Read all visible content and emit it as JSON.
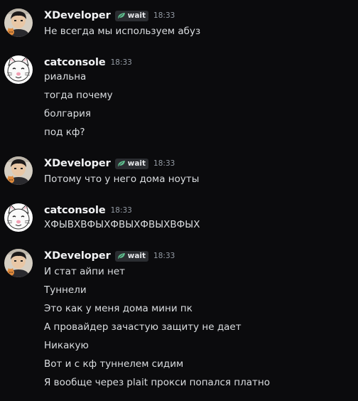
{
  "groups": [
    {
      "username": "XDeveloper",
      "tag": "wait",
      "timestamp": "18:33",
      "avatar": "xdeveloper-avatar",
      "lines": [
        "Не всегда мы используем абуз"
      ]
    },
    {
      "username": "catconsole",
      "timestamp": "18:33",
      "avatar": "catconsole-avatar",
      "lines": [
        "риальна",
        "тогда почему",
        "болгария",
        "под кф?"
      ]
    },
    {
      "username": "XDeveloper",
      "tag": "wait",
      "timestamp": "18:33",
      "avatar": "xdeveloper-avatar",
      "lines": [
        "Потому что у него дома ноуты"
      ]
    },
    {
      "username": "catconsole",
      "timestamp": "18:33",
      "avatar": "catconsole-avatar",
      "lines": [
        "ХФЫВХВФЫХФВЫХФВЫХВФЫХ"
      ]
    },
    {
      "username": "XDeveloper",
      "tag": "wait",
      "timestamp": "18:33",
      "avatar": "xdeveloper-avatar",
      "lines": [
        "И стат айпи нет",
        "Туннели",
        "Это как у меня дома мини пк",
        "А провайдер зачастую защиту не дает",
        "Никакую",
        "Вот и с кф туннелем сидим",
        "Я вообще через plait прокси попался платно"
      ]
    }
  ],
  "colors": {
    "background": "#0b0b0d",
    "username": "#f2f3f5",
    "text": "#dbdee1",
    "timestamp": "#949ba4",
    "tag_bg": "#2b2d31",
    "tag_icon": "#5fbf8f"
  }
}
